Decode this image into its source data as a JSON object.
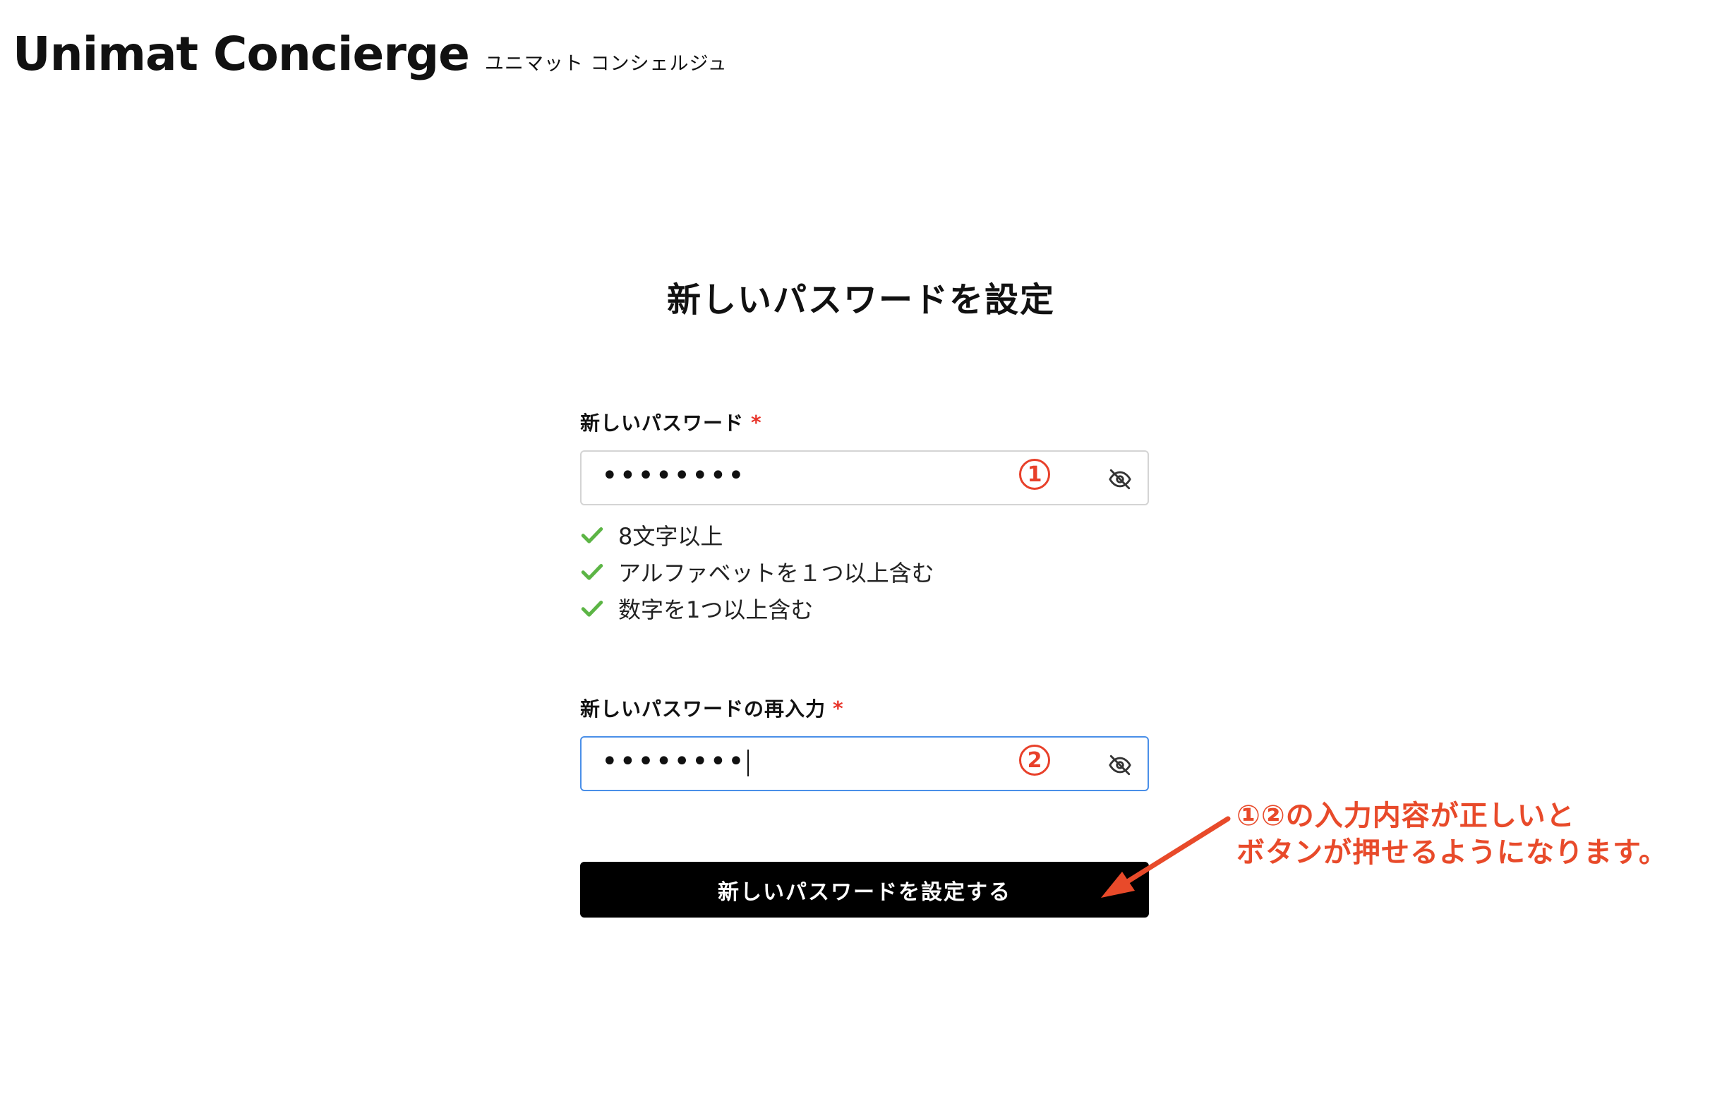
{
  "header": {
    "logo_text": "Unimat Concierge",
    "logo_sub": "ユニマット コンシェルジュ"
  },
  "main": {
    "title": "新しいパスワードを設定",
    "new_password": {
      "label": "新しいパスワード",
      "required_mark": "*",
      "value": "••••••••",
      "marker": "1",
      "toggle_icon": "eye-off-icon"
    },
    "rules": [
      {
        "text": "8文字以上",
        "icon": "check-icon"
      },
      {
        "text": "アルファベットを１つ以上含む",
        "icon": "check-icon"
      },
      {
        "text": "数字を1つ以上含む",
        "icon": "check-icon"
      }
    ],
    "confirm_password": {
      "label": "新しいパスワードの再入力",
      "required_mark": "*",
      "value": "••••••••",
      "marker": "2",
      "toggle_icon": "eye-off-icon"
    },
    "submit_label": "新しいパスワードを設定する"
  },
  "annotation": {
    "line1": "①②の入力内容が正しいと",
    "line2": "ボタンが押せるようになります。"
  },
  "colors": {
    "accent_red": "#e84a2a",
    "check_green": "#5cb545",
    "focus_blue": "#4a8fe8",
    "button_bg": "#000000"
  }
}
